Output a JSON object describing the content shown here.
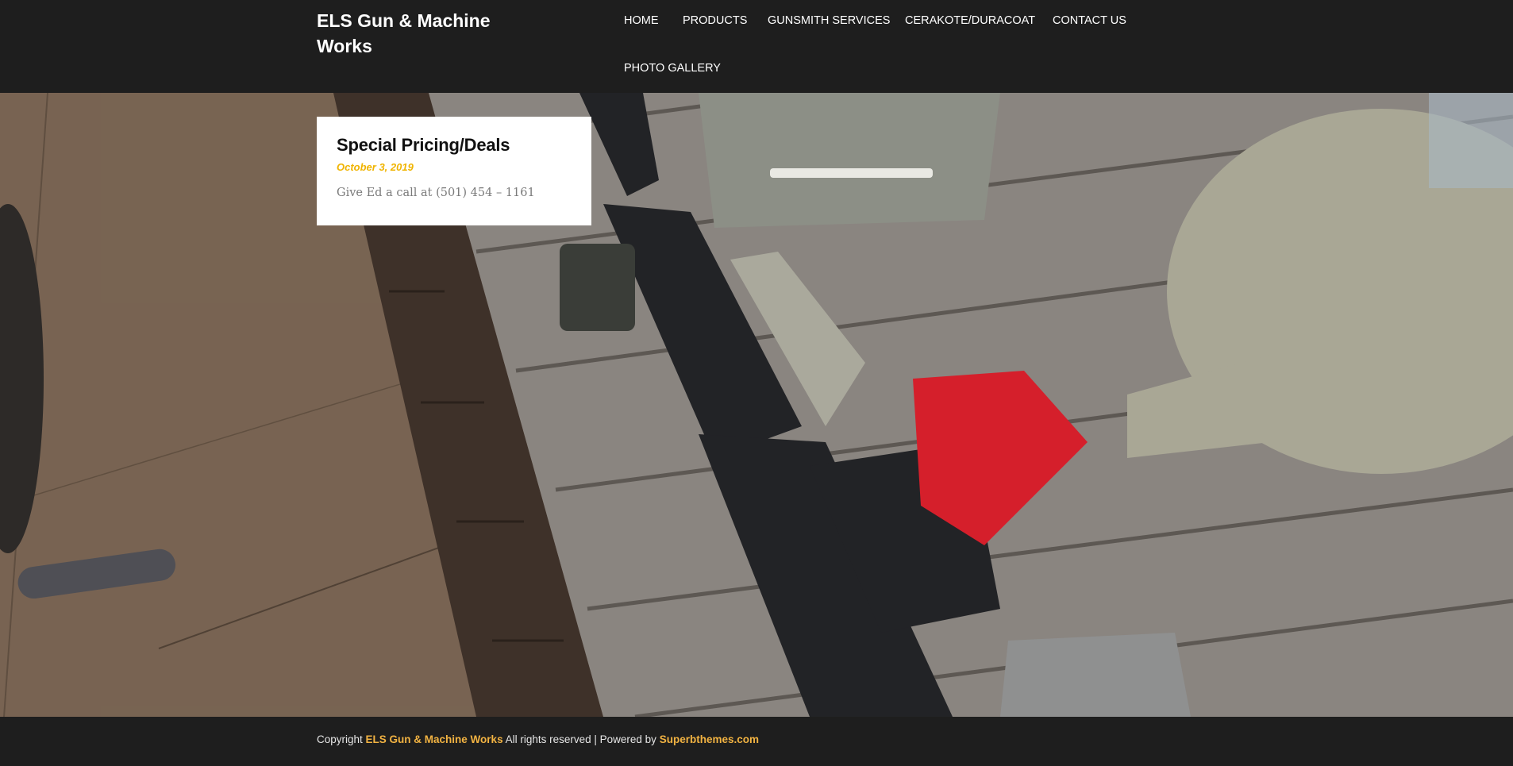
{
  "header": {
    "site_title": "ELS Gun & Machine Works",
    "nav": [
      {
        "label": "HOME"
      },
      {
        "label": "PRODUCTS"
      },
      {
        "label": "GUNSMITH SERVICES"
      },
      {
        "label": "CERAKOTE/DURACOAT"
      },
      {
        "label": "CONTACT US"
      },
      {
        "label": "PHOTO GALLERY"
      }
    ]
  },
  "post": {
    "title": "Special Pricing/Deals",
    "date": "October 3, 2019",
    "excerpt": "Give Ed a call at (501) 454 – 1161"
  },
  "footer": {
    "copyright_prefix": "Copyright",
    "site_link": "ELS Gun & Machine Works",
    "rights_text": "All rights reserved | Powered by",
    "powered_link": "Superbthemes.com"
  },
  "colors": {
    "header_bg": "#1e1e1e",
    "accent": "#f2b342",
    "date_color": "#f0b400"
  }
}
